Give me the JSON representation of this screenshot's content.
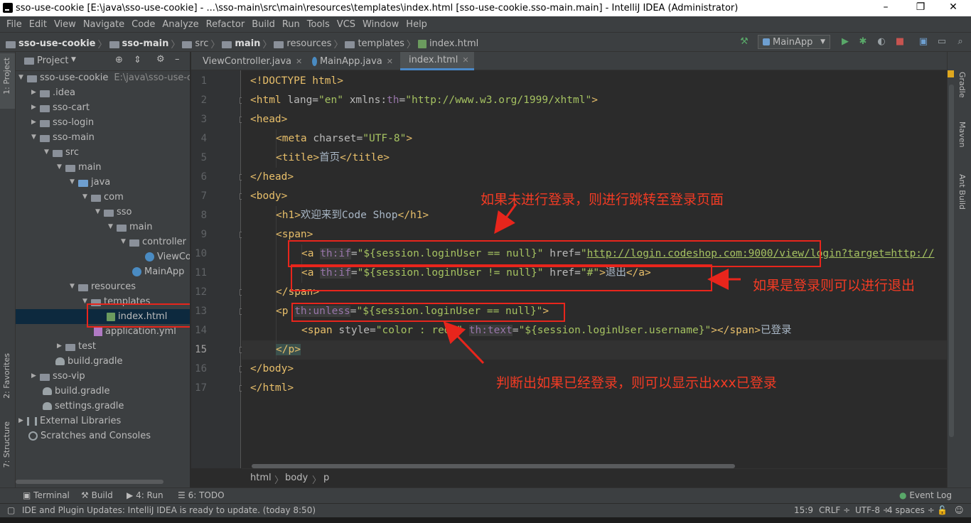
{
  "window": {
    "title": "sso-use-cookie [E:\\java\\sso-use-cookie] - ...\\sso-main\\src\\main\\resources\\templates\\index.html [sso-use-cookie.sso-main.main] - IntelliJ IDEA (Administrator)",
    "minimize": "–",
    "maximize": "❐",
    "close": "✕"
  },
  "menu": [
    "File",
    "Edit",
    "View",
    "Navigate",
    "Code",
    "Analyze",
    "Refactor",
    "Build",
    "Run",
    "Tools",
    "VCS",
    "Window",
    "Help"
  ],
  "breadcrumbs": [
    "sso-use-cookie",
    "sso-main",
    "src",
    "main",
    "resources",
    "templates",
    "index.html"
  ],
  "run_config": "MainApp",
  "left_tabs": {
    "project": "1: Project",
    "favorites": "2: Favorites",
    "structure": "7: Structure"
  },
  "project_panel": {
    "title": "Project"
  },
  "tree": [
    {
      "label": "sso-use-cookie",
      "path": "E:\\java\\sso-use-co"
    },
    {
      "label": ".idea"
    },
    {
      "label": "sso-cart"
    },
    {
      "label": "sso-login"
    },
    {
      "label": "sso-main"
    },
    {
      "label": "src"
    },
    {
      "label": "main"
    },
    {
      "label": "java"
    },
    {
      "label": "com"
    },
    {
      "label": "sso"
    },
    {
      "label": "main"
    },
    {
      "label": "controller"
    },
    {
      "label": "ViewCo"
    },
    {
      "label": "MainApp"
    },
    {
      "label": "resources"
    },
    {
      "label": "templates"
    },
    {
      "label": "index.html"
    },
    {
      "label": "application.yml"
    },
    {
      "label": "test"
    },
    {
      "label": "build.gradle"
    },
    {
      "label": "sso-vip"
    },
    {
      "label": "build.gradle"
    },
    {
      "label": "settings.gradle"
    },
    {
      "label": "External Libraries"
    },
    {
      "label": "Scratches and Consoles"
    }
  ],
  "tabs": [
    {
      "label": "ViewController.java"
    },
    {
      "label": "MainApp.java"
    },
    {
      "label": "index.html"
    }
  ],
  "code": {
    "line_numbers": [
      "1",
      "2",
      "3",
      "4",
      "5",
      "6",
      "7",
      "8",
      "9",
      "10",
      "11",
      "12",
      "13",
      "14",
      "15",
      "16",
      "17"
    ],
    "l1": "<!DOCTYPE html>",
    "l2_a": "<html ",
    "l2_b": "lang=",
    "l2_c": "\"en\"",
    "l2_d": " xmlns:",
    "l2_e": "th",
    "l2_f": "=",
    "l2_g": "\"http://www.w3.org/1999/xhtml\"",
    "l2_h": ">",
    "l3": "<head>",
    "l4_a": "<meta ",
    "l4_b": "charset=",
    "l4_c": "\"UTF-8\"",
    "l4_d": ">",
    "l5_a": "<title>",
    "l5_b": "首页",
    "l5_c": "</title>",
    "l6": "</head>",
    "l7": "<body>",
    "l8_a": "<h1>",
    "l8_b": "欢迎来到Code Shop",
    "l8_c": "</h1>",
    "l9": "<span>",
    "l10_a": "<a ",
    "l10_b": "th:if",
    "l10_c": "=",
    "l10_d": "\"${session.loginUser == null}\"",
    "l10_e": " href=",
    "l10_f": "\"",
    "l10_g": "http://login.codeshop.com:9000/view/login?target=http://",
    "l11_a": "<a ",
    "l11_b": "th:if",
    "l11_c": "=",
    "l11_d": "\"${session.loginUser != null}\"",
    "l11_e": " href=",
    "l11_f": "\"#\"",
    "l11_g": ">",
    "l11_h": "退出",
    "l11_i": "</a>",
    "l12": "</span>",
    "l13_a": "<p ",
    "l13_b": "th:unless",
    "l13_c": "=",
    "l13_d": "\"${session.loginUser == null}\"",
    "l13_e": ">",
    "l14_a": "<span ",
    "l14_b": "style=",
    "l14_c": "\"color : red;\"",
    "l14_d": " ",
    "l14_e": "th:text",
    "l14_f": "=",
    "l14_g": "\"${session.loginUser.username}\"",
    "l14_h": "></span>",
    "l14_i": "已登录",
    "l15": "</p>",
    "l16": "</body>",
    "l17": "</html>"
  },
  "annotations": {
    "a1": "如果未进行登录，则进行跳转至登录页面",
    "a2": "如果是登录则可以进行退出",
    "a3": "判断出如果已经登录，则可以显示出xxx已登录"
  },
  "right_tabs": {
    "gradle": "Gradle",
    "maven": "Maven",
    "ant": "Ant Build"
  },
  "editor_breadcrumb": [
    "html",
    "body",
    "p"
  ],
  "bottom_tools": {
    "terminal": "Terminal",
    "build": "Build",
    "run": "4: Run",
    "todo": "6: TODO",
    "event_log": "Event Log"
  },
  "status": {
    "message": "IDE and Plugin Updates: IntelliJ IDEA is ready to update. (today 8:50)",
    "position": "15:9",
    "line_sep": "CRLF ÷",
    "encoding": "UTF-8 ÷",
    "indent": "4 spaces ÷"
  }
}
